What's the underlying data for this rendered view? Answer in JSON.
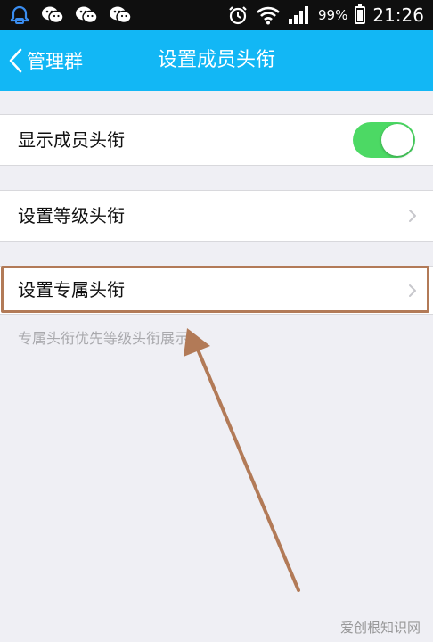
{
  "status_bar": {
    "battery_percent": "99%",
    "time": "21:26",
    "left_icons": [
      "notification-icon",
      "wechat-icon",
      "wechat-icon",
      "wechat-icon"
    ],
    "right_icons": [
      "alarm-icon",
      "wifi-icon",
      "signal-icon",
      "battery-icon"
    ]
  },
  "nav": {
    "back_label": "管理群",
    "title": "设置成员头衔"
  },
  "settings": {
    "show_titles_label": "显示成员头衔",
    "show_titles_enabled": true,
    "level_title_label": "设置等级头衔",
    "exclusive_title_label": "设置专属头衔",
    "footnote": "专属头衔优先等级头衔展示"
  },
  "watermark": "爱创根知识网",
  "colors": {
    "nav_bg": "#12b7f5",
    "toggle_on": "#4cd964",
    "annotation": "#b27a57",
    "page_bg": "#efeff4"
  }
}
